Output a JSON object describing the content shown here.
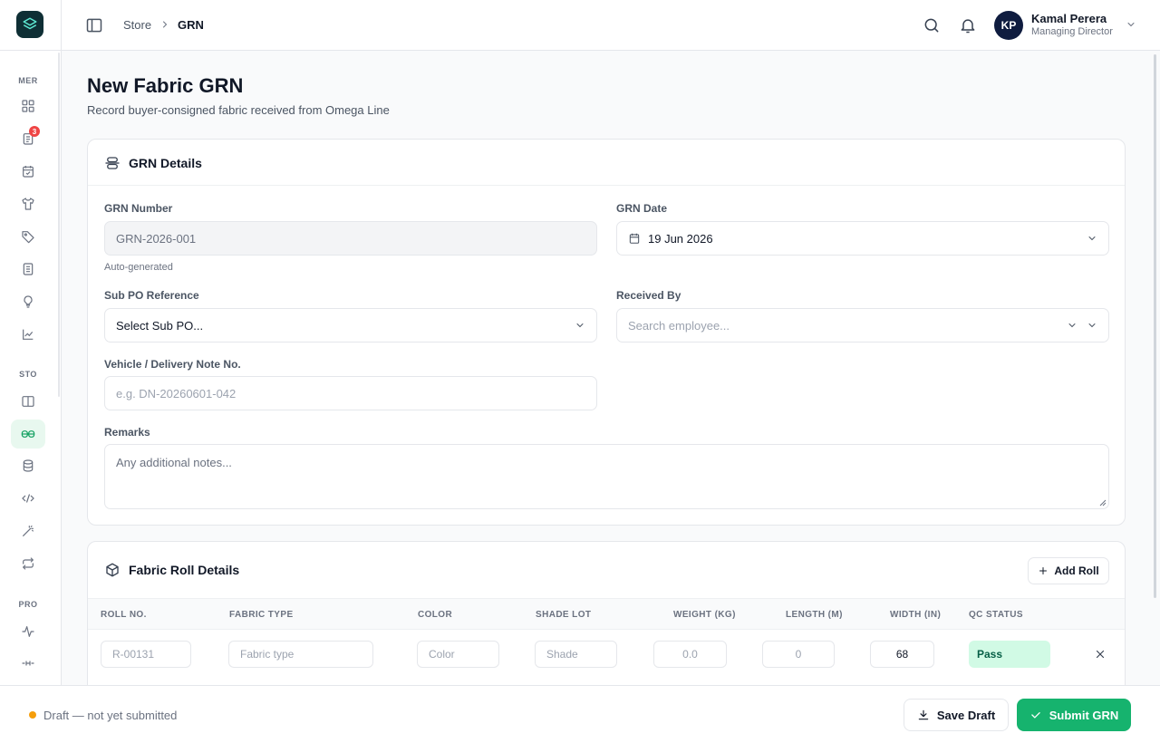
{
  "sidebar": {
    "sections": [
      "MER",
      "STO",
      "PRO"
    ],
    "badge_count": "3",
    "icons": [
      "dashboard-icon",
      "orders-icon",
      "calendar-icon",
      "garment-icon",
      "tag-icon",
      "document-icon",
      "lightbulb-icon",
      "chart-icon",
      "book-icon",
      "grn-icon",
      "database-icon",
      "transfer-icon",
      "wand-icon",
      "repeat-icon",
      "activity-icon",
      "dash-icon"
    ]
  },
  "header": {
    "breadcrumb": [
      "Store",
      "GRN"
    ],
    "user": {
      "initials": "KP",
      "name": "Kamal Perera",
      "role": "Managing Director"
    }
  },
  "page": {
    "title": "New Fabric GRN",
    "subtitle": "Record buyer-consigned fabric received from Omega Line"
  },
  "grn_details": {
    "title": "GRN Details",
    "grn_number": {
      "label": "GRN Number",
      "value": "GRN-2026-001",
      "hint": "Auto-generated"
    },
    "grn_date": {
      "label": "GRN Date",
      "value": "19 Jun 2026"
    },
    "sub_po": {
      "label": "Sub PO Reference",
      "value": "Select Sub PO..."
    },
    "received_by": {
      "label": "Received By",
      "placeholder": "Search employee..."
    },
    "vehicle": {
      "label": "Vehicle / Delivery Note No.",
      "placeholder": "e.g. DN-20260601-042"
    },
    "remarks": {
      "label": "Remarks",
      "placeholder": "Any additional notes..."
    }
  },
  "roll_details": {
    "title": "Fabric Roll Details",
    "add_label": "Add Roll",
    "columns": [
      "ROLL NO.",
      "FABRIC TYPE",
      "COLOR",
      "SHADE LOT",
      "WEIGHT (KG)",
      "LENGTH (M)",
      "WIDTH (IN)",
      "QC STATUS"
    ],
    "rows": [
      {
        "roll_no": "R-00131",
        "fabric_type": "Fabric type",
        "color": "Color",
        "shade": "Shade",
        "weight": "0.0",
        "length": "0",
        "width": "68",
        "qc": "Pass"
      }
    ]
  },
  "footer": {
    "status": "Draft — not yet submitted",
    "save_label": "Save Draft",
    "submit_label": "Submit GRN"
  },
  "colors": {
    "accent": "#16b36e",
    "brand": "#0f2f35",
    "draft": "#f59e0b",
    "danger": "#ef4444"
  }
}
